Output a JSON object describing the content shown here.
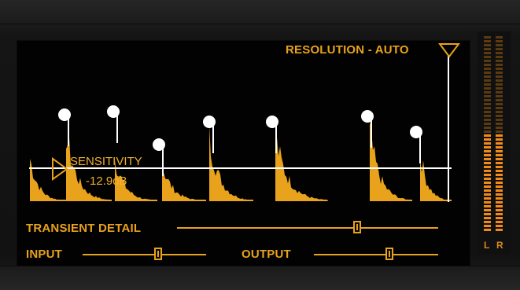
{
  "display": {
    "resolution_label": "RESOLUTION - AUTO",
    "sensitivity_label": "SENSITIVITY",
    "sensitivity_value": "-12.9dB"
  },
  "controls": {
    "transient_detail_label": "TRANSIENT DETAIL",
    "input_label": "INPUT",
    "output_label": "OUTPUT",
    "transient_detail_level": 0.69,
    "input_level": 0.61,
    "output_level": 0.61
  },
  "meter": {
    "left_label": "L",
    "right_label": "R",
    "left_level": 0.5,
    "right_level": 0.5
  },
  "colors": {
    "accent": "#e8a21c",
    "waveform": "#e8a21c",
    "marker": "#ffffff",
    "meter_lit": "#f08a1a",
    "meter_dim": "#5a3a10"
  }
}
